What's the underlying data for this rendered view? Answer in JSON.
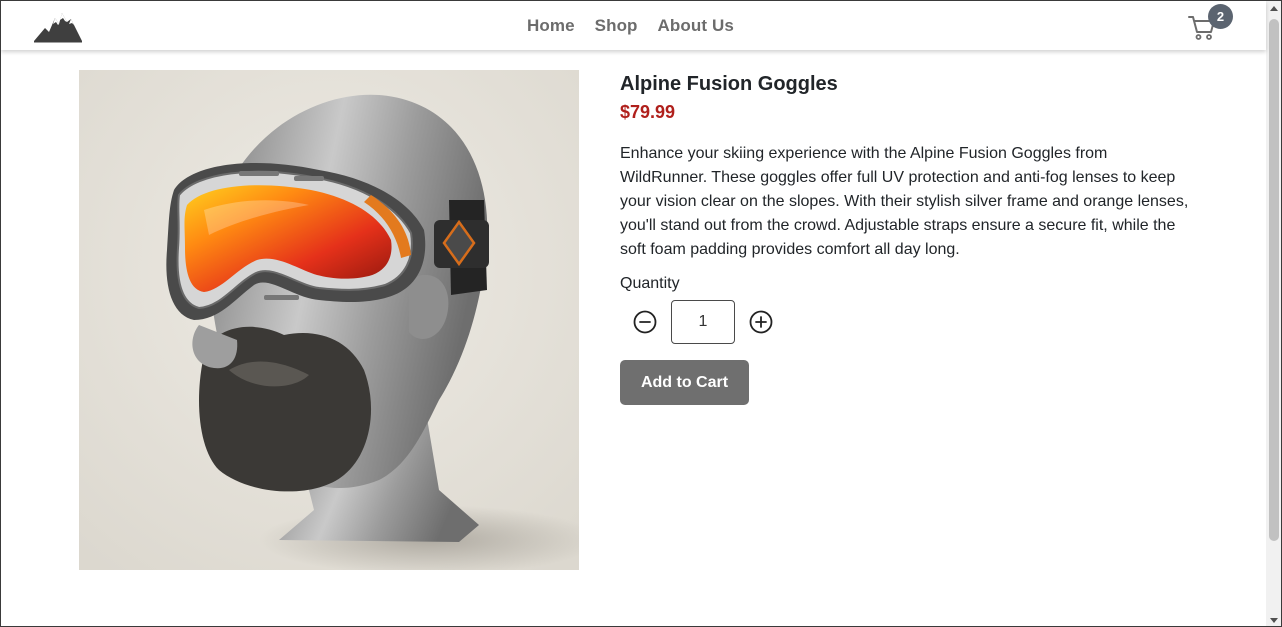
{
  "nav": {
    "links": [
      "Home",
      "Shop",
      "About Us"
    ],
    "cart_count": "2"
  },
  "product": {
    "name": "Alpine Fusion Goggles",
    "price": "$79.99",
    "description": "Enhance your skiing experience with the Alpine Fusion Goggles from WildRunner. These goggles offer full UV protection and anti-fog lenses to keep your vision clear on the slopes. With their stylish silver frame and orange lenses, you'll stand out from the crowd. Adjustable straps ensure a secure fit, while the soft foam padding provides comfort all day long.",
    "quantity_label": "Quantity",
    "quantity_value": "1",
    "add_to_cart_label": "Add to Cart"
  },
  "icons": {
    "logo": "mountain-logo-icon",
    "cart": "cart-icon",
    "minus": "minus-circle-icon",
    "plus": "plus-circle-icon"
  },
  "colors": {
    "price": "#b0201c",
    "button": "#6f6f6f",
    "badge": "#5b6470",
    "nav_link": "#6c6c6c"
  }
}
